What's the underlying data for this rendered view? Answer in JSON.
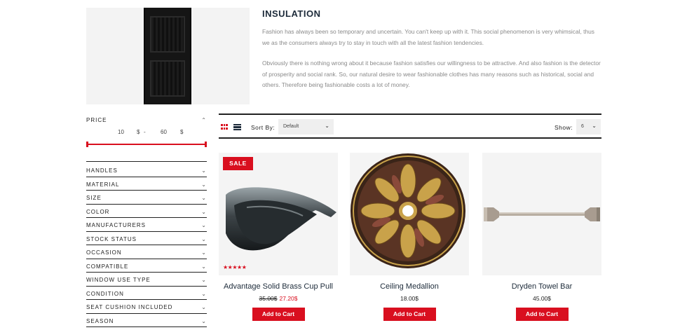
{
  "category": {
    "title": "INSULATION",
    "paragraphs": [
      "Fashion has always been so temporary and uncertain. You can't keep up with it. This social phenomenon is very whimsical, thus we as the consumers always try to stay in touch with all the latest fashion tendencies.",
      "Obviously there is nothing wrong about it because fashion satisfies our willingness to be attractive. And also fashion is the detector of prosperity and social rank. So, our natural desire to wear fashionable clothes has many reasons such as historical, social and others. Therefore being fashionable costs a lot of money."
    ]
  },
  "sidebar": {
    "price": {
      "label": "PRICE",
      "min": "10",
      "min_currency": "$",
      "dash": "-",
      "max": "60",
      "max_currency": "$"
    },
    "filters": [
      "HANDLES",
      "MATERIAL",
      "SIZE",
      "COLOR",
      "MANUFACTURERS",
      "STOCK STATUS",
      "OCCASION",
      "COMPATIBLE",
      "WINDOW USE TYPE",
      "CONDITION",
      "SEAT CUSHION INCLUDED",
      "SEASON"
    ]
  },
  "toolbar": {
    "sort_label": "Sort By:",
    "sort_value": "Default",
    "show_label": "Show:",
    "show_value": "6"
  },
  "products": [
    {
      "name": "Advantage Solid Brass Cup Pull",
      "old_price": "35.00$",
      "price": "27.20$",
      "badge": "SALE",
      "stars": "★★★★★",
      "button": "Add to Cart"
    },
    {
      "name": "Ceiling Medallion",
      "price": "18.00$",
      "button": "Add to Cart"
    },
    {
      "name": "Dryden Towel Bar",
      "price": "45.00$",
      "button": "Add to Cart"
    }
  ],
  "colors": {
    "accent": "#d90f1f",
    "text_dark": "#1d2b3a"
  },
  "icons": {
    "grid_view": "grid-icon",
    "list_view": "list-icon",
    "expand": "chevron-down-icon",
    "collapse": "chevron-up-icon"
  }
}
